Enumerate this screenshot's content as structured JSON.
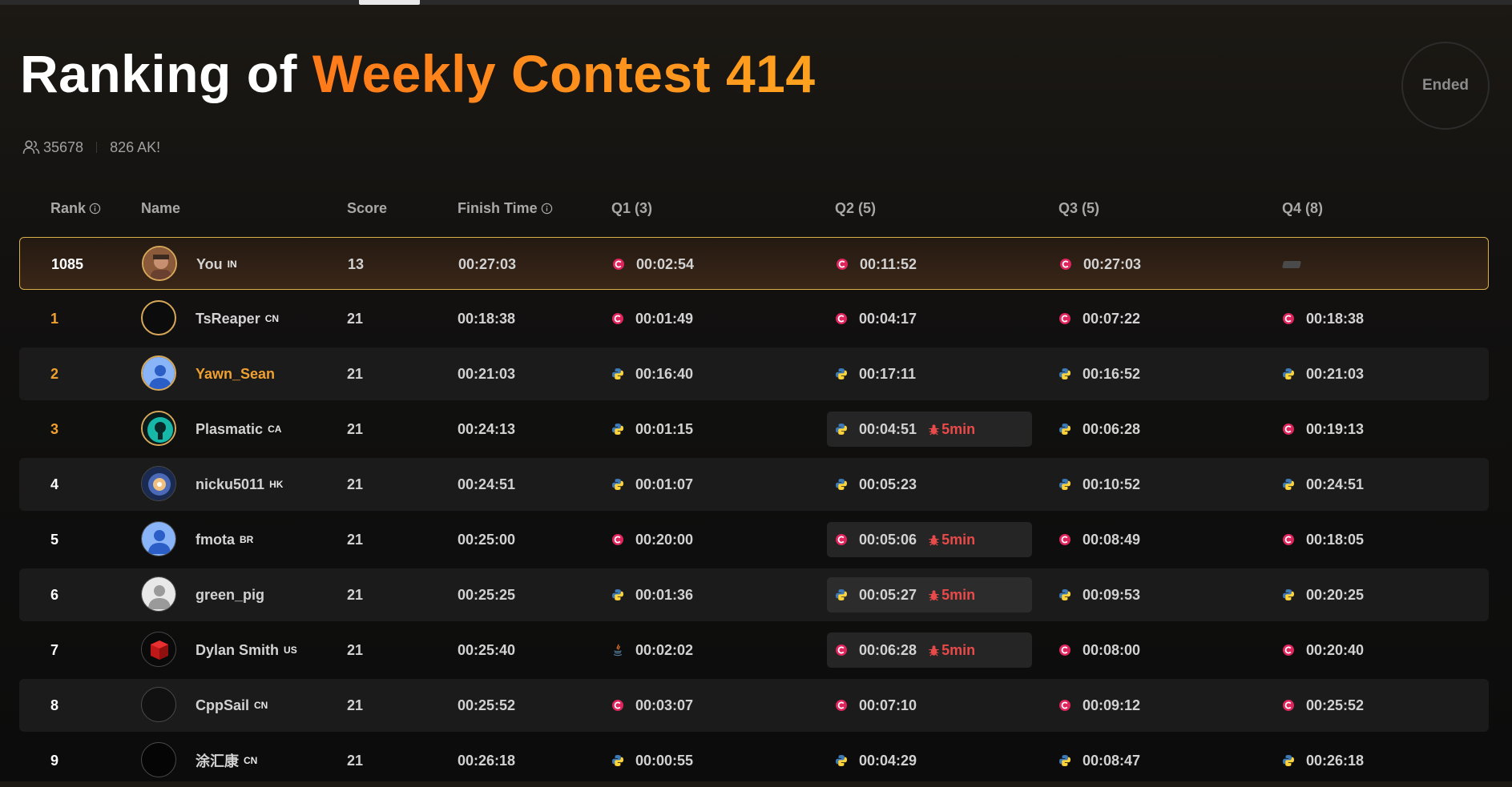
{
  "page": {
    "title_prefix": "Ranking of",
    "title_accent": "Weekly Contest 414",
    "status": "Ended",
    "participants": "35678",
    "ak_count": "826 AK!"
  },
  "colors": {
    "accent_orange": "#ff8a1f",
    "gold_border": "#d8b04a",
    "penalty_red": "#e84a4a",
    "cpp_icon": "#e0245e",
    "python_blue": "#3d7ab8",
    "python_yellow": "#ffd43b"
  },
  "table": {
    "headers": {
      "rank": "Rank",
      "name": "Name",
      "score": "Score",
      "finish": "Finish Time",
      "q1": "Q1 (3)",
      "q2": "Q2 (5)",
      "q3": "Q3 (5)",
      "q4": "Q4 (8)"
    },
    "rows": [
      {
        "rank": "1085",
        "name": "You",
        "country": "IN",
        "score": "13",
        "finish": "00:27:03",
        "q": [
          {
            "lang": "cpp-icon",
            "time": "00:02:54"
          },
          {
            "lang": "cpp-icon",
            "time": "00:11:52"
          },
          {
            "lang": "cpp-icon",
            "time": "00:27:03"
          },
          {
            "unsolved": true
          }
        ]
      },
      {
        "rank": "1",
        "name": "TsReaper",
        "country": "CN",
        "score": "21",
        "finish": "00:18:38",
        "q": [
          {
            "lang": "cpp-icon",
            "time": "00:01:49"
          },
          {
            "lang": "cpp-icon",
            "time": "00:04:17"
          },
          {
            "lang": "cpp-icon",
            "time": "00:07:22"
          },
          {
            "lang": "cpp-icon",
            "time": "00:18:38"
          }
        ]
      },
      {
        "rank": "2",
        "name": "Yawn_Sean",
        "country": "",
        "score": "21",
        "finish": "00:21:03",
        "q": [
          {
            "lang": "python-icon",
            "time": "00:16:40"
          },
          {
            "lang": "python-icon",
            "time": "00:17:11"
          },
          {
            "lang": "python-icon",
            "time": "00:16:52"
          },
          {
            "lang": "python-icon",
            "time": "00:21:03"
          }
        ]
      },
      {
        "rank": "3",
        "name": "Plasmatic",
        "country": "CA",
        "score": "21",
        "finish": "00:24:13",
        "q": [
          {
            "lang": "python-icon",
            "time": "00:01:15"
          },
          {
            "lang": "python-icon",
            "time": "00:04:51",
            "penalty": "5min"
          },
          {
            "lang": "python-icon",
            "time": "00:06:28"
          },
          {
            "lang": "cpp-icon",
            "time": "00:19:13"
          }
        ]
      },
      {
        "rank": "4",
        "name": "nicku5011",
        "country": "HK",
        "score": "21",
        "finish": "00:24:51",
        "q": [
          {
            "lang": "python-icon",
            "time": "00:01:07"
          },
          {
            "lang": "python-icon",
            "time": "00:05:23"
          },
          {
            "lang": "python-icon",
            "time": "00:10:52"
          },
          {
            "lang": "python-icon",
            "time": "00:24:51"
          }
        ]
      },
      {
        "rank": "5",
        "name": "fmota",
        "country": "BR",
        "score": "21",
        "finish": "00:25:00",
        "q": [
          {
            "lang": "cpp-icon",
            "time": "00:20:00"
          },
          {
            "lang": "cpp-icon",
            "time": "00:05:06",
            "penalty": "5min"
          },
          {
            "lang": "cpp-icon",
            "time": "00:08:49"
          },
          {
            "lang": "cpp-icon",
            "time": "00:18:05"
          }
        ]
      },
      {
        "rank": "6",
        "name": "green_pig",
        "country": "",
        "score": "21",
        "finish": "00:25:25",
        "q": [
          {
            "lang": "python-icon",
            "time": "00:01:36"
          },
          {
            "lang": "python-icon",
            "time": "00:05:27",
            "penalty": "5min"
          },
          {
            "lang": "python-icon",
            "time": "00:09:53"
          },
          {
            "lang": "python-icon",
            "time": "00:20:25"
          }
        ]
      },
      {
        "rank": "7",
        "name": "Dylan Smith",
        "country": "US",
        "score": "21",
        "finish": "00:25:40",
        "q": [
          {
            "lang": "java-icon",
            "time": "00:02:02"
          },
          {
            "lang": "cpp-icon",
            "time": "00:06:28",
            "penalty": "5min"
          },
          {
            "lang": "cpp-icon",
            "time": "00:08:00"
          },
          {
            "lang": "cpp-icon",
            "time": "00:20:40"
          }
        ]
      },
      {
        "rank": "8",
        "name": "CppSail",
        "country": "CN",
        "score": "21",
        "finish": "00:25:52",
        "q": [
          {
            "lang": "cpp-icon",
            "time": "00:03:07"
          },
          {
            "lang": "cpp-icon",
            "time": "00:07:10"
          },
          {
            "lang": "cpp-icon",
            "time": "00:09:12"
          },
          {
            "lang": "cpp-icon",
            "time": "00:25:52"
          }
        ]
      },
      {
        "rank": "9",
        "name": "涂汇康",
        "country": "CN",
        "score": "21",
        "finish": "00:26:18",
        "q": [
          {
            "lang": "python-icon",
            "time": "00:00:55"
          },
          {
            "lang": "python-icon",
            "time": "00:04:29"
          },
          {
            "lang": "python-icon",
            "time": "00:08:47"
          },
          {
            "lang": "python-icon",
            "time": "00:26:18"
          }
        ]
      }
    ]
  }
}
